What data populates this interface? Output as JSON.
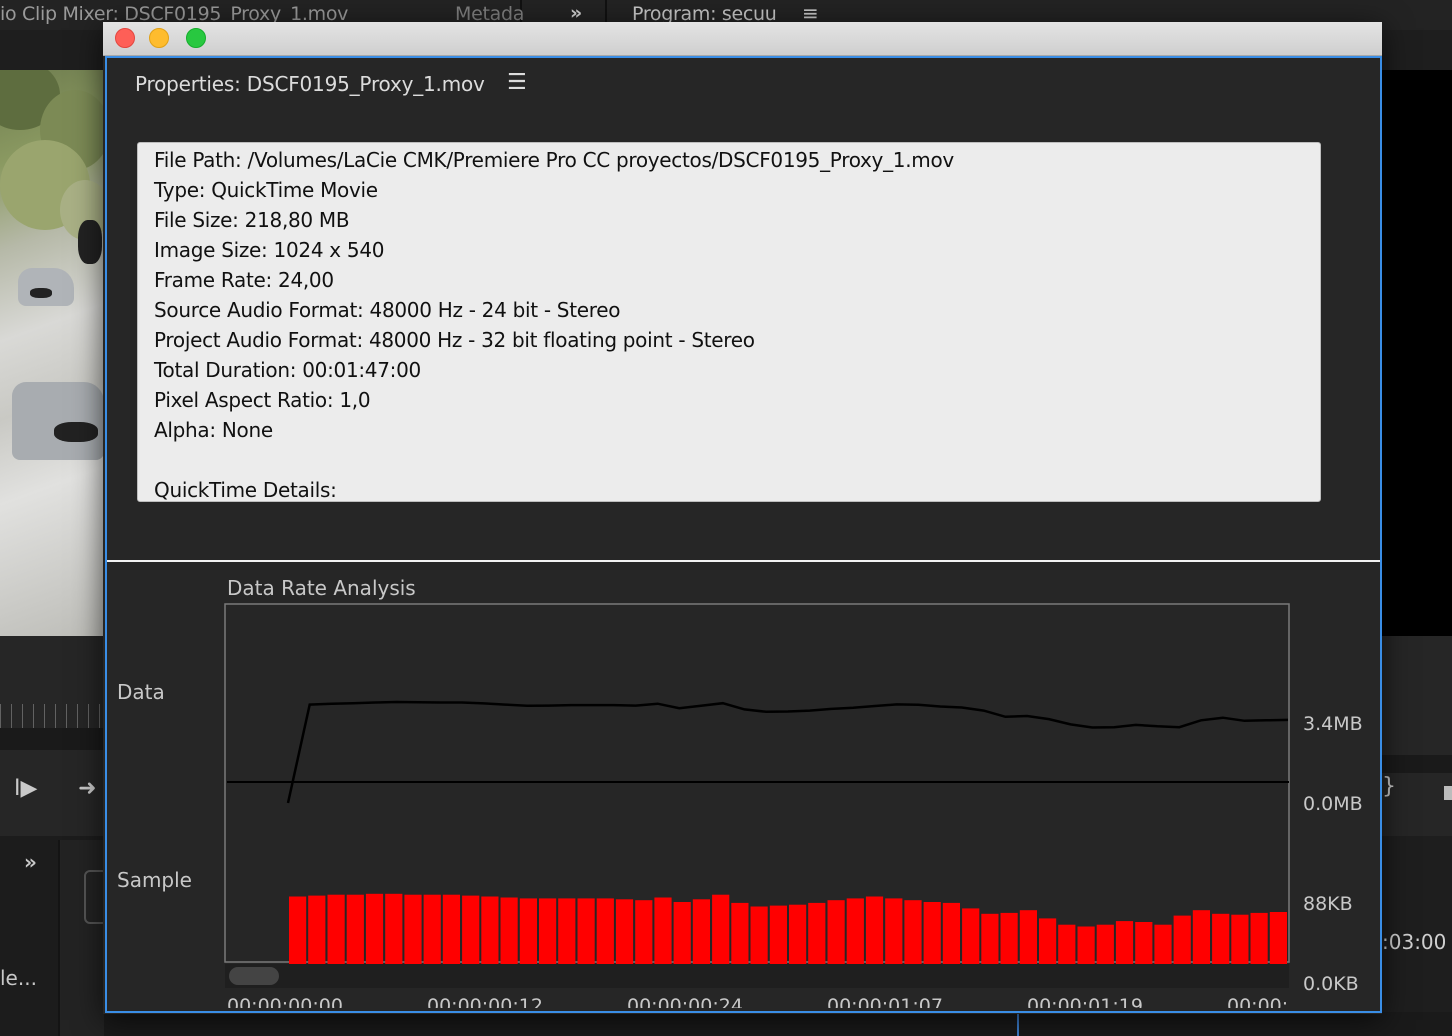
{
  "background": {
    "tabs": {
      "mixer": "io Clip Mixer: DSCF0195_Proxy_1.mov",
      "metadata": "Metada",
      "chevrons": "»",
      "program": "Program: secuu",
      "program_menu": "≡"
    },
    "controls": {
      "step_forward": "I▶",
      "arrow_right": "➜",
      "brace": "}",
      "left_chevrons": "»",
      "left_label": "le..."
    },
    "timecode": ":03:00"
  },
  "window": {
    "panel_title": "Properties: DSCF0195_Proxy_1.mov",
    "menu_icon": "hamburger-menu-icon",
    "properties": [
      "File Path: /Volumes/LaCie CMK/Premiere Pro CC proyectos/DSCF0195_Proxy_1.mov",
      "Type: QuickTime Movie",
      "File Size: 218,80 MB",
      "Image Size: 1024 x 540",
      "Frame Rate: 24,00",
      "Source Audio Format: 48000 Hz - 24 bit - Stereo",
      "Project Audio Format: 48000 Hz - 32 bit floating point - Stereo",
      "Total Duration: 00:01:47:00",
      "Pixel Aspect Ratio: 1,0",
      "Alpha: None",
      "",
      "QuickTime Details:"
    ]
  },
  "analysis": {
    "title": "Data Rate Analysis",
    "label_data": "Data",
    "label_sample": "Sample"
  },
  "chart_data": [
    {
      "type": "line",
      "name": "Data",
      "y_labels": [
        "3.4MB",
        "0.0MB"
      ],
      "ylim": [
        0,
        4.4
      ],
      "color": "#000000",
      "values": [
        0.0,
        4.13,
        4.17,
        4.19,
        4.22,
        4.24,
        4.23,
        4.22,
        4.22,
        4.18,
        4.13,
        4.08,
        4.09,
        4.11,
        4.11,
        4.11,
        4.09,
        4.17,
        3.98,
        4.08,
        4.19,
        3.93,
        3.83,
        3.84,
        3.88,
        3.95,
        4.0,
        4.07,
        4.14,
        4.12,
        4.05,
        4.01,
        3.88,
        3.62,
        3.65,
        3.52,
        3.3,
        3.17,
        3.18,
        3.28,
        3.22,
        3.18,
        3.47,
        3.58,
        3.45,
        3.47,
        3.49
      ]
    },
    {
      "type": "bar",
      "name": "Sample",
      "y_labels": [
        "88KB",
        "0.0KB"
      ],
      "ylim": [
        0,
        115
      ],
      "color": "#ff0000",
      "x_tick_labels": [
        "00;00;00;00",
        "00;00;00;12",
        "00;00;00;24",
        "00;00;01;07",
        "00;00;01;19",
        "00;00;"
      ],
      "values": [
        94,
        95,
        96,
        96,
        97,
        97,
        96,
        96,
        96,
        95,
        94,
        93,
        92,
        92,
        92,
        92,
        92,
        91,
        90,
        93,
        88,
        91,
        96,
        87,
        83,
        84,
        85,
        87,
        90,
        92,
        94,
        92,
        90,
        88,
        87,
        81,
        75,
        76,
        79,
        70,
        63,
        61,
        63,
        67,
        66,
        63,
        73,
        79,
        75,
        74,
        76,
        77
      ]
    }
  ]
}
